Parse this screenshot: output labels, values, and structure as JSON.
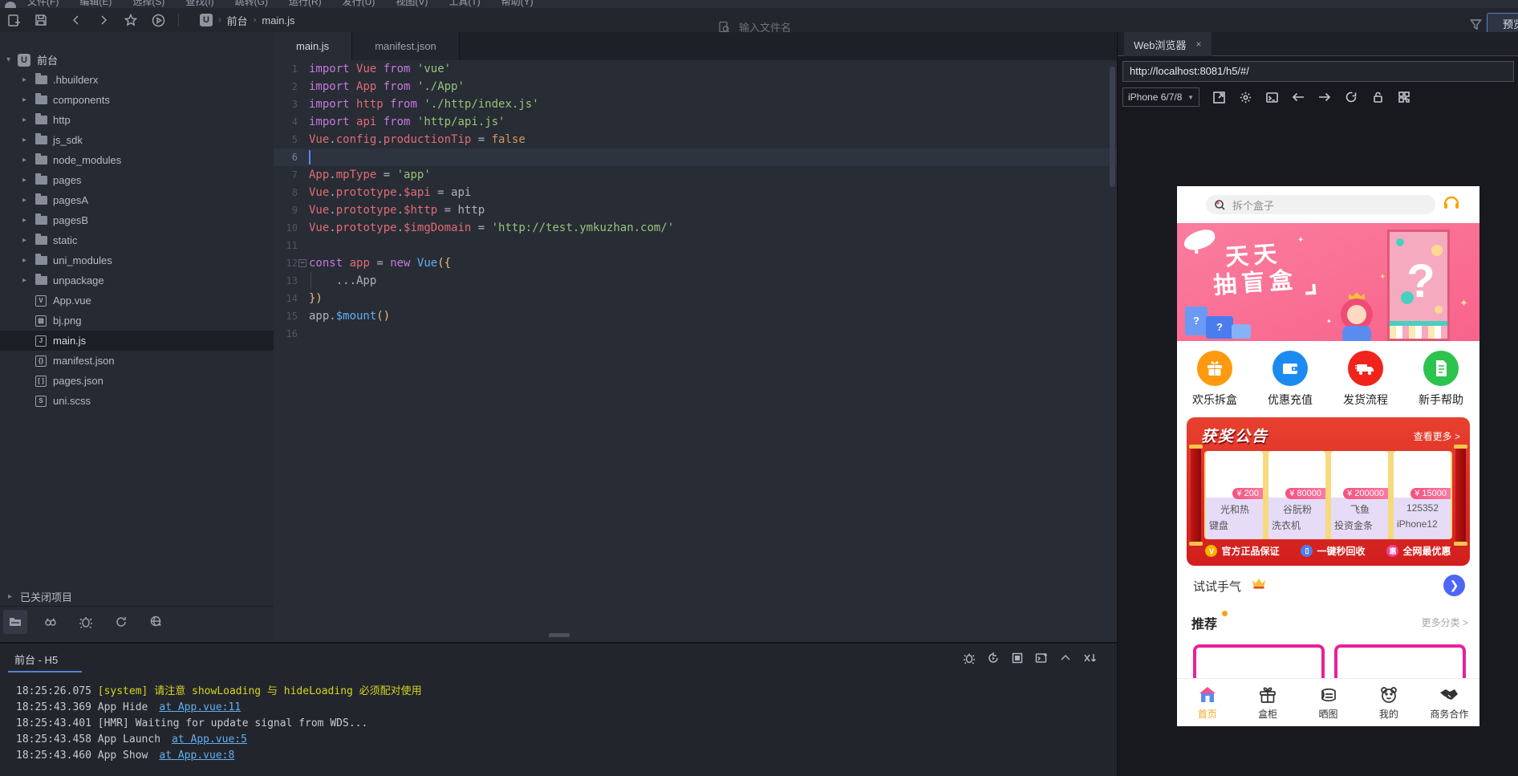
{
  "menubar": {
    "items": [
      "文件(F)",
      "编辑(E)",
      "选择(S)",
      "查找(I)",
      "跳转(G)",
      "运行(R)",
      "发行(U)",
      "视图(V)",
      "工具(T)",
      "帮助(Y)"
    ]
  },
  "toolbar": {
    "breadcrumb": {
      "project": "前台",
      "file": "main.js"
    },
    "search_placeholder": "输入文件名",
    "preview_button": "预览"
  },
  "sidebar": {
    "project": "前台",
    "tree": [
      {
        "label": ".hbuilderx",
        "icon": "folder",
        "chevron": true
      },
      {
        "label": "components",
        "icon": "folder",
        "chevron": true
      },
      {
        "label": "http",
        "icon": "folder",
        "chevron": true
      },
      {
        "label": "js_sdk",
        "icon": "folder",
        "chevron": true
      },
      {
        "label": "node_modules",
        "icon": "folder",
        "chevron": true
      },
      {
        "label": "pages",
        "icon": "folder",
        "chevron": true
      },
      {
        "label": "pagesA",
        "icon": "folder",
        "chevron": true
      },
      {
        "label": "pagesB",
        "icon": "folder",
        "chevron": true
      },
      {
        "label": "static",
        "icon": "folder",
        "chevron": true
      },
      {
        "label": "uni_modules",
        "icon": "folder",
        "chevron": true
      },
      {
        "label": "unpackage",
        "icon": "folder",
        "chevron": true
      },
      {
        "label": "App.vue",
        "icon": "V"
      },
      {
        "label": "bj.png",
        "icon": "▨"
      },
      {
        "label": "main.js",
        "icon": "J",
        "selected": true
      },
      {
        "label": "manifest.json",
        "icon": "{}"
      },
      {
        "label": "pages.json",
        "icon": "[ ]"
      },
      {
        "label": "uni.scss",
        "icon": "S"
      }
    ],
    "closed_projects": "已关闭项目"
  },
  "editor": {
    "tabs": [
      {
        "label": "main.js",
        "active": true
      },
      {
        "label": "manifest.json",
        "active": false
      }
    ],
    "lines": [
      {
        "n": 1,
        "t": [
          [
            "k",
            "import"
          ],
          [
            "o",
            " "
          ],
          [
            "v",
            "Vue"
          ],
          [
            "o",
            " "
          ],
          [
            "k",
            "from"
          ],
          [
            "o",
            " "
          ],
          [
            "s",
            "'vue'"
          ]
        ]
      },
      {
        "n": 2,
        "t": [
          [
            "k",
            "import"
          ],
          [
            "o",
            " "
          ],
          [
            "v",
            "App"
          ],
          [
            "o",
            " "
          ],
          [
            "k",
            "from"
          ],
          [
            "o",
            " "
          ],
          [
            "s",
            "'./App'"
          ]
        ]
      },
      {
        "n": 3,
        "t": [
          [
            "k",
            "import"
          ],
          [
            "o",
            " "
          ],
          [
            "v",
            "http"
          ],
          [
            "o",
            " "
          ],
          [
            "k",
            "from"
          ],
          [
            "o",
            " "
          ],
          [
            "s",
            "'./http/index.js'"
          ]
        ]
      },
      {
        "n": 4,
        "t": [
          [
            "k",
            "import"
          ],
          [
            "o",
            " "
          ],
          [
            "v",
            "api"
          ],
          [
            "o",
            " "
          ],
          [
            "k",
            "from"
          ],
          [
            "o",
            " "
          ],
          [
            "s",
            "'http/api.js'"
          ]
        ]
      },
      {
        "n": 5,
        "t": [
          [
            "v",
            "Vue"
          ],
          [
            "o",
            "."
          ],
          [
            "v",
            "config"
          ],
          [
            "o",
            "."
          ],
          [
            "v",
            "productionTip"
          ],
          [
            "o",
            " = "
          ],
          [
            "b",
            "false"
          ]
        ]
      },
      {
        "n": 6,
        "t": [],
        "cursor": true
      },
      {
        "n": 7,
        "t": [
          [
            "v",
            "App"
          ],
          [
            "o",
            "."
          ],
          [
            "v",
            "mpType"
          ],
          [
            "o",
            " = "
          ],
          [
            "s",
            "'app'"
          ]
        ]
      },
      {
        "n": 8,
        "t": [
          [
            "v",
            "Vue"
          ],
          [
            "o",
            "."
          ],
          [
            "v",
            "prototype"
          ],
          [
            "o",
            "."
          ],
          [
            "v",
            "$api"
          ],
          [
            "o",
            " = api"
          ]
        ]
      },
      {
        "n": 9,
        "t": [
          [
            "v",
            "Vue"
          ],
          [
            "o",
            "."
          ],
          [
            "v",
            "prototype"
          ],
          [
            "o",
            "."
          ],
          [
            "v",
            "$http"
          ],
          [
            "o",
            " = http"
          ]
        ]
      },
      {
        "n": 10,
        "t": [
          [
            "v",
            "Vue"
          ],
          [
            "o",
            "."
          ],
          [
            "v",
            "prototype"
          ],
          [
            "o",
            "."
          ],
          [
            "v",
            "$imgDomain"
          ],
          [
            "o",
            " = "
          ],
          [
            "s",
            "'http://test.ymkuzhan.com/'"
          ]
        ]
      },
      {
        "n": 11,
        "t": []
      },
      {
        "n": 12,
        "fold": true,
        "t": [
          [
            "k",
            "const"
          ],
          [
            "o",
            " "
          ],
          [
            "v",
            "app"
          ],
          [
            "o",
            " = "
          ],
          [
            "k",
            "new"
          ],
          [
            "o",
            " "
          ],
          [
            "c",
            "Vue"
          ],
          [
            "p",
            "({"
          ]
        ]
      },
      {
        "n": 13,
        "guide": true,
        "t": [
          [
            "o",
            "    ...App"
          ]
        ]
      },
      {
        "n": 14,
        "t": [
          [
            "p",
            "})"
          ]
        ]
      },
      {
        "n": 15,
        "t": [
          [
            "o",
            "app."
          ],
          [
            "f",
            "$mount"
          ],
          [
            "p",
            "()"
          ]
        ]
      },
      {
        "n": 16,
        "t": []
      }
    ]
  },
  "console": {
    "tab": "前台 - H5",
    "logs": [
      {
        "time": "18:25:26.075",
        "text": "[system] 请注意 showLoading 与 hideLoading 必须配对使用",
        "type": "warn"
      },
      {
        "time": "18:25:43.369",
        "text": "App Hide",
        "link": "at App.vue:11"
      },
      {
        "time": "18:25:43.401",
        "text": "[HMR] Waiting for update signal from WDS...",
        "type": "plain"
      },
      {
        "time": "18:25:43.458",
        "text": "App Launch",
        "link": "at App.vue:5"
      },
      {
        "time": "18:25:43.460",
        "text": "App Show",
        "link": "at App.vue:8"
      }
    ]
  },
  "browser": {
    "tab": "Web浏览器",
    "close": "×",
    "url": "http://localhost:8081/h5/#/",
    "device": "iPhone 6/7/8"
  },
  "phone": {
    "search_placeholder": "拆个盒子",
    "banner": {
      "line1": "天天",
      "line2": "抽盲盒",
      "question_mark": "?",
      "box_mark": "?"
    },
    "shortcuts": [
      {
        "label": "欢乐拆盒",
        "color": "#ff9a0e",
        "icon": "gift"
      },
      {
        "label": "优惠充值",
        "color": "#1b8bf0",
        "icon": "wallet"
      },
      {
        "label": "发货流程",
        "color": "#f0241b",
        "icon": "truck"
      },
      {
        "label": "新手帮助",
        "color": "#2cc34e",
        "icon": "doc"
      }
    ],
    "announcement": {
      "title": "获奖公告",
      "more": "查看更多 >",
      "prizes": [
        {
          "price": "¥ 200",
          "line1": "光和热",
          "line2": "键盘"
        },
        {
          "price": "¥ 80000",
          "line1": "谷朊粉",
          "line2": "洗衣机"
        },
        {
          "price": "¥ 200000",
          "line1": "飞鱼",
          "line2": "投资金条"
        },
        {
          "price": "¥ 15000",
          "line1": "125352",
          "line2": "iPhone12"
        }
      ],
      "badges": [
        {
          "label": "官方正品保证",
          "color": "#f7b500",
          "glyph": "V"
        },
        {
          "label": "一键秒回收",
          "color": "#4d7df2",
          "glyph": "▯"
        },
        {
          "label": "全网最优惠",
          "color": "#f0439a",
          "glyph": "惠"
        }
      ]
    },
    "luck": {
      "label": "试试手气",
      "arrow": "❯"
    },
    "recommend": {
      "label": "推荐",
      "more": "更多分类 >"
    },
    "tabbar": [
      {
        "label": "首页",
        "icon": "home",
        "active": true
      },
      {
        "label": "盒柜",
        "icon": "box"
      },
      {
        "label": "晒图",
        "icon": "photo"
      },
      {
        "label": "我的",
        "icon": "bear"
      },
      {
        "label": "商务合作",
        "icon": "hands"
      }
    ]
  }
}
